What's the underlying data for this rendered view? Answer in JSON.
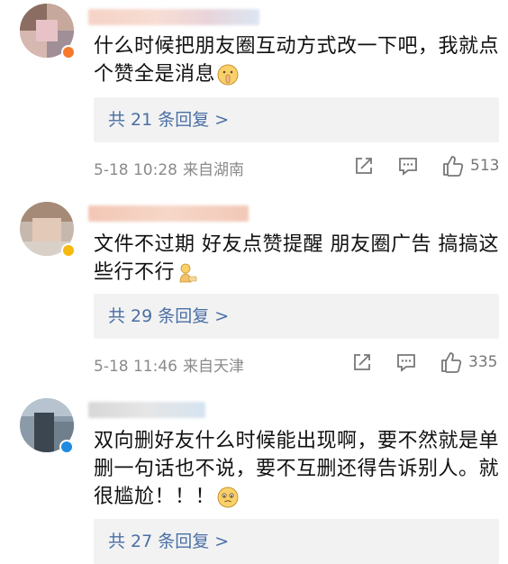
{
  "comments": [
    {
      "text": "什么时候把朋友圈互动方式改一下吧，我就点个赞全是消息",
      "emoji": "shushing-face-emoji",
      "replies_label": "共 21 条回复 >",
      "time": "5-18 10:28",
      "location": "来自湖南",
      "likes": "513"
    },
    {
      "text": "文件不过期 好友点赞提醒 朋友圈广告 搞搞这些行不行",
      "emoji": "sitting-figure-emoji",
      "replies_label": "共 29 条回复 >",
      "time": "5-18 11:46",
      "location": "来自天津",
      "likes": "335"
    },
    {
      "text": "双向删好友什么时候能出现啊，要不然就是单删一句话也不说，要不互删还得告诉别人。就很尴尬！！！",
      "emoji": "pleading-face-emoji",
      "replies_label": "共 27 条回复 >"
    }
  ],
  "colors": {
    "link": "#4a6fa5",
    "meta": "#8a8a8a",
    "reply_bg": "#f2f2f2",
    "badge_orange": "#f7792b",
    "badge_yellow": "#f5b90f",
    "badge_blue": "#1d8ce0"
  }
}
